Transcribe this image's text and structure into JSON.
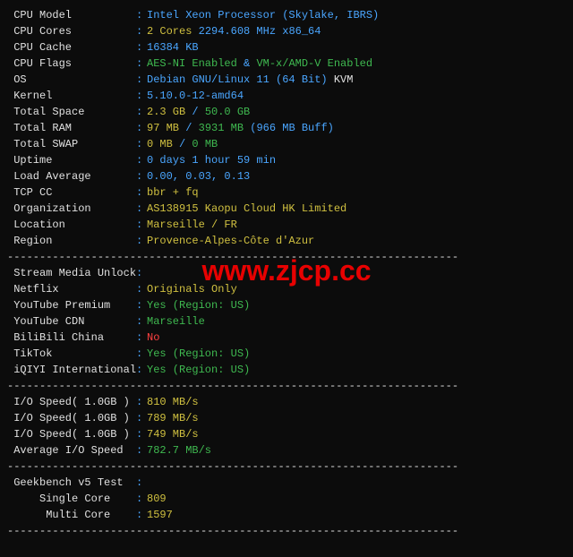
{
  "sysinfo": {
    "cpu_model_label": " CPU Model",
    "cpu_model": "Intel Xeon Processor (Skylake, IBRS)",
    "cpu_cores_label": " CPU Cores",
    "cpu_cores_count": "2 Cores",
    "cpu_cores_freq": " 2294.608 MHz x86_64",
    "cpu_cache_label": " CPU Cache",
    "cpu_cache": "16384 KB",
    "cpu_flags_label": " CPU Flags",
    "cpu_flags_aes": "AES-NI Enabled",
    "cpu_flags_amp": " & ",
    "cpu_flags_vmx": "VM-x/AMD-V Enabled",
    "os_label": " OS",
    "os": "Debian GNU/Linux 11 (64 Bit)",
    "os_hyper": " KVM",
    "kernel_label": " Kernel",
    "kernel": "5.10.0-12-amd64",
    "space_label": " Total Space",
    "space_used": "2.3 GB",
    "space_sep": " / ",
    "space_total": "50.0 GB",
    "ram_label": " Total RAM",
    "ram_used": "97 MB",
    "ram_sep": " / ",
    "ram_total": "3931 MB",
    "ram_buff": " (966 MB Buff)",
    "swap_label": " Total SWAP",
    "swap_used": "0 MB",
    "swap_sep": " / ",
    "swap_total": "0 MB",
    "uptime_label": " Uptime",
    "uptime": "0 days 1 hour 59 min",
    "load_label": " Load Average",
    "load": "0.00, 0.03, 0.13",
    "tcp_label": " TCP CC",
    "tcp": "bbr + fq",
    "org_label": " Organization",
    "org": "AS138915 Kaopu Cloud HK Limited",
    "loc_label": " Location",
    "loc": "Marseille / FR",
    "region_label": " Region",
    "region": "Provence-Alpes-Côte d'Azur"
  },
  "stream": {
    "header": " Stream Media Unlock",
    "netflix_label": " Netflix",
    "netflix": "Originals Only",
    "ytp_label": " YouTube Premium",
    "ytp": "Yes (Region: US)",
    "ytcdn_label": " YouTube CDN",
    "ytcdn": "Marseille",
    "bili_label": " BiliBili China",
    "bili": "No",
    "tiktok_label": " TikTok",
    "tiktok": "Yes (Region: US)",
    "iqiyi_label": " iQIYI International",
    "iqiyi": "Yes (Region: US)"
  },
  "io": {
    "r1_label": " I/O Speed( 1.0GB )",
    "r1": "810 MB/s",
    "r2_label": " I/O Speed( 1.0GB )",
    "r2": "789 MB/s",
    "r3_label": " I/O Speed( 1.0GB )",
    "r3": "749 MB/s",
    "avg_label": " Average I/O Speed",
    "avg": "782.7 MB/s"
  },
  "geek": {
    "header": " Geekbench v5 Test",
    "single_label": "     Single Core",
    "single": "809",
    "multi_label": "      Multi Core",
    "multi": "1597"
  },
  "divider": "----------------------------------------------------------------------",
  "watermark": "www.zjcp.cc"
}
